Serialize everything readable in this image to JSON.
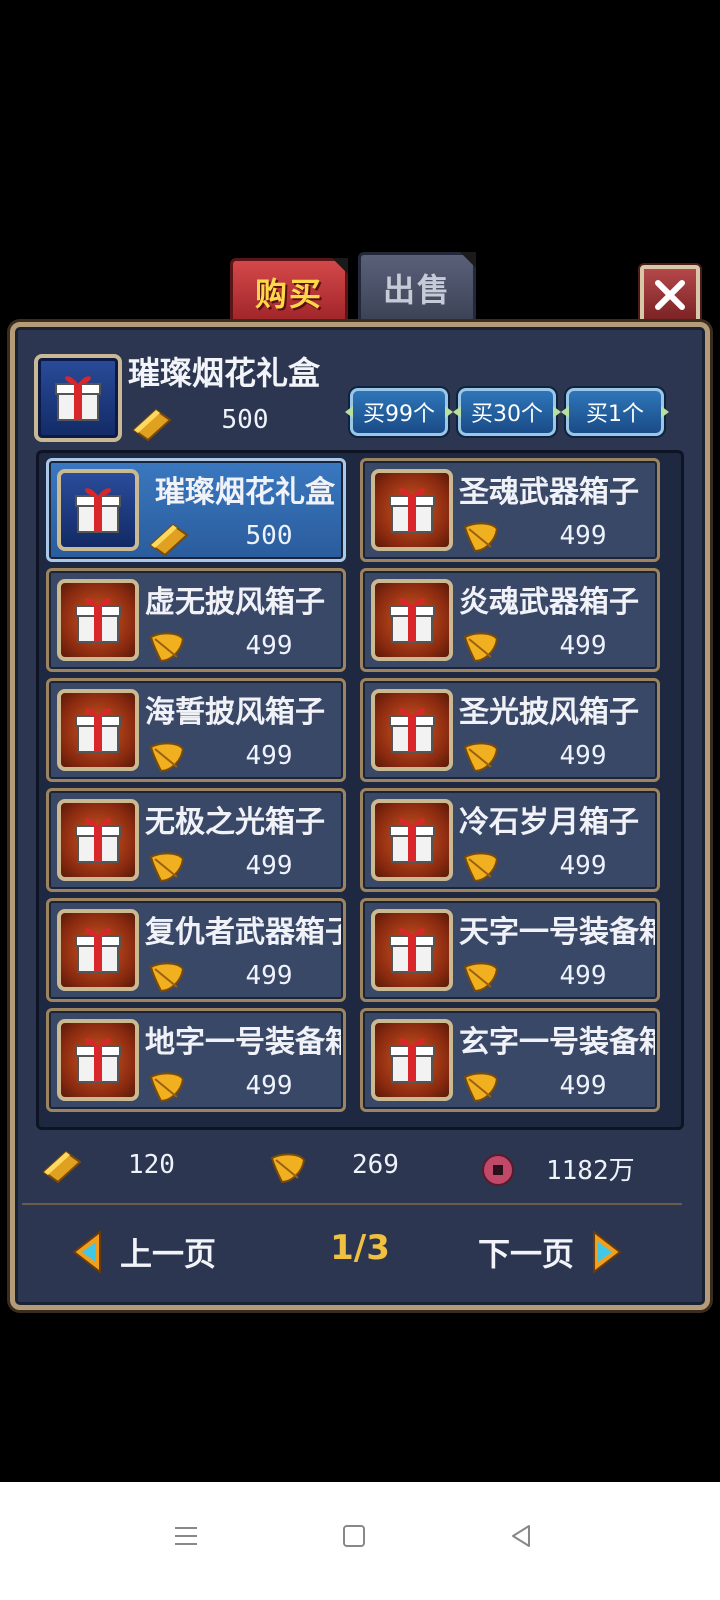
{
  "tabs": {
    "buy": "购买",
    "sell": "出售"
  },
  "selected_item": {
    "name": "璀璨烟花礼盒",
    "price": "500",
    "currency_icon": "gold-ingot-icon"
  },
  "quantity_buttons": {
    "buy99": "买99个",
    "buy30": "买30个",
    "buy1": "买1个"
  },
  "items": [
    {
      "name": "璀璨烟花礼盒",
      "price": "500",
      "currency": "gold-ingot-icon",
      "selected": true
    },
    {
      "name": "圣魂武器箱子",
      "price": "499",
      "currency": "leaf-icon"
    },
    {
      "name": "虚无披风箱子",
      "price": "499",
      "currency": "leaf-icon"
    },
    {
      "name": "炎魂武器箱子",
      "price": "499",
      "currency": "leaf-icon"
    },
    {
      "name": "海誓披风箱子",
      "price": "499",
      "currency": "leaf-icon"
    },
    {
      "name": "圣光披风箱子",
      "price": "499",
      "currency": "leaf-icon"
    },
    {
      "name": "无极之光箱子",
      "price": "499",
      "currency": "leaf-icon"
    },
    {
      "name": "冷石岁月箱子",
      "price": "499",
      "currency": "leaf-icon"
    },
    {
      "name": "复仇者武器箱子",
      "price": "499",
      "currency": "leaf-icon"
    },
    {
      "name": "天字一号装备箱子",
      "price": "499",
      "currency": "leaf-icon"
    },
    {
      "name": "地字一号装备箱子",
      "price": "499",
      "currency": "leaf-icon"
    },
    {
      "name": "玄字一号装备箱子",
      "price": "499",
      "currency": "leaf-icon"
    }
  ],
  "balances": {
    "gold": "120",
    "leaf": "269",
    "coin": "1182万"
  },
  "pager": {
    "prev": "上一页",
    "next": "下一页",
    "page": "1/3"
  },
  "colors": {
    "gold": "#f0c040",
    "panel": "#2c3650",
    "selected": "#3a78c0",
    "border": "#b49c78"
  }
}
